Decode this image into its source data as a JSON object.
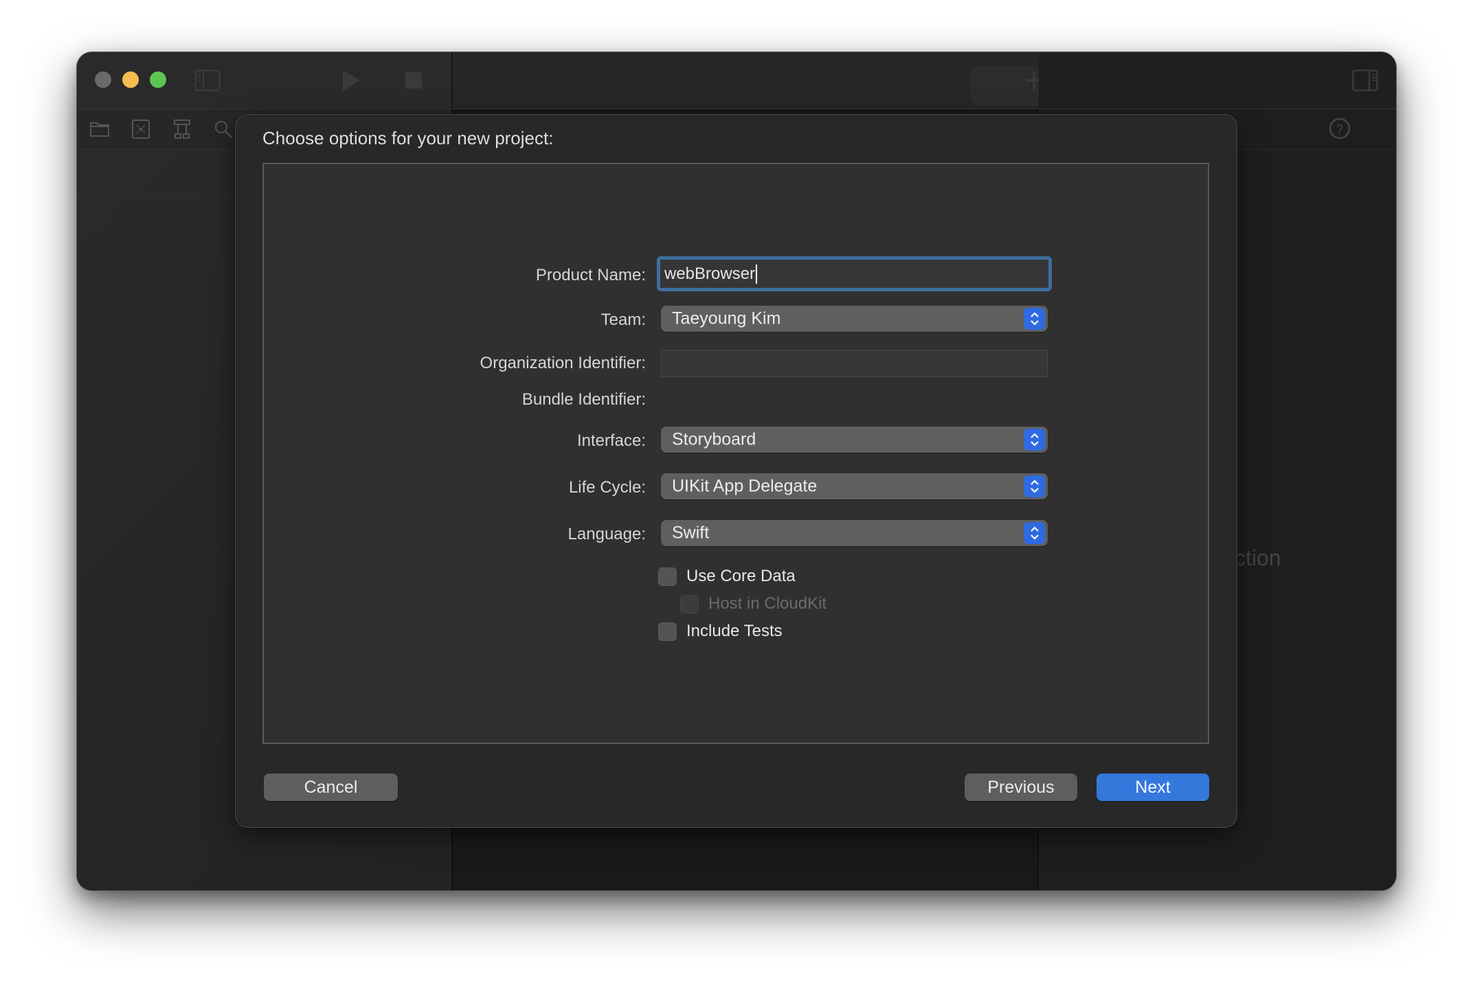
{
  "window": {
    "traffic_lights": [
      "close",
      "minimize",
      "zoom"
    ],
    "toolbar_icons": [
      "sidebar-toggle-icon",
      "play-icon",
      "stop-icon",
      "plus-icon",
      "swap-icon",
      "inspector-toggle-icon"
    ],
    "navigator_icons": [
      "folder-icon",
      "source-control-icon",
      "hierarchy-icon",
      "search-icon"
    ],
    "help_icon": "help-icon",
    "editor_ghost_text": "ction"
  },
  "sheet": {
    "title": "Choose options for your new project:",
    "form": {
      "product_name": {
        "label": "Product Name:",
        "value": "webBrowser"
      },
      "team": {
        "label": "Team:",
        "value": "Taeyoung Kim"
      },
      "organization_identifier": {
        "label": "Organization Identifier:",
        "value": ""
      },
      "bundle_identifier": {
        "label": "Bundle Identifier:",
        "value": ""
      },
      "interface": {
        "label": "Interface:",
        "value": "Storyboard"
      },
      "life_cycle": {
        "label": "Life Cycle:",
        "value": "UIKit App Delegate"
      },
      "language": {
        "label": "Language:",
        "value": "Swift"
      }
    },
    "checkboxes": [
      {
        "label": "Use Core Data",
        "checked": false,
        "enabled": true
      },
      {
        "label": "Host in CloudKit",
        "checked": false,
        "enabled": false
      },
      {
        "label": "Include Tests",
        "checked": false,
        "enabled": true
      }
    ],
    "buttons": {
      "cancel": "Cancel",
      "previous": "Previous",
      "next": "Next"
    }
  },
  "colors": {
    "accent": "#3478dc",
    "focus_ring": "#3f6e9f",
    "traffic_close_inactive": "#6a6a6a",
    "traffic_minimize": "#f4bd4f",
    "traffic_zoom": "#5ec552"
  }
}
